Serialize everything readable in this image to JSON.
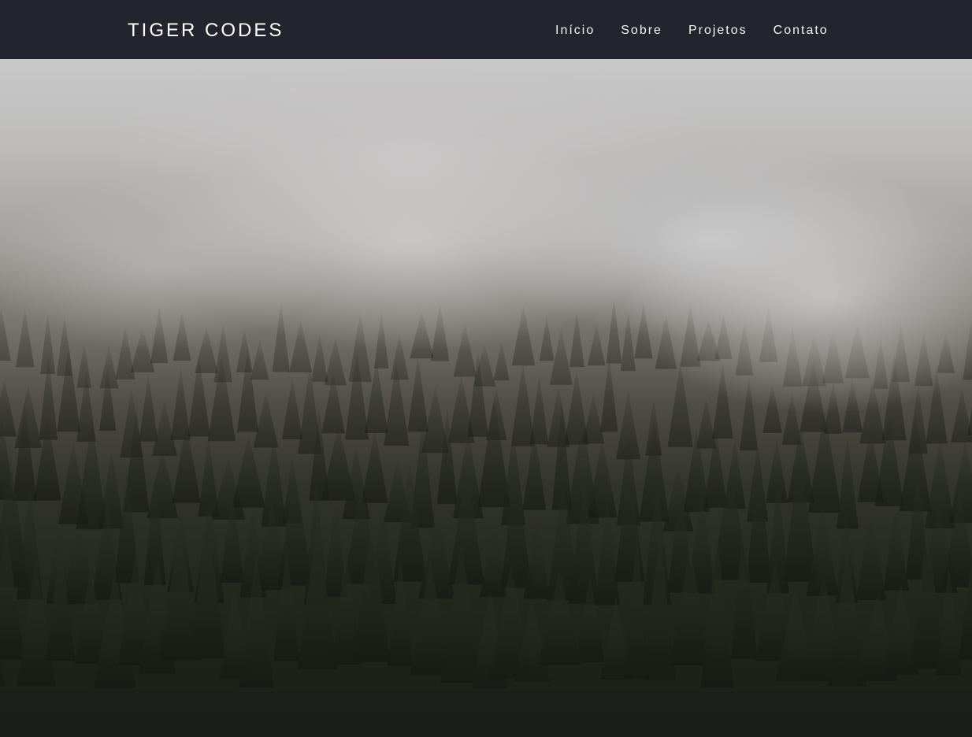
{
  "site": {
    "brand": "TIGER CODES"
  },
  "nav": {
    "items": [
      {
        "label": "Início"
      },
      {
        "label": "Sobre"
      },
      {
        "label": "Projetos"
      },
      {
        "label": "Contato"
      }
    ]
  },
  "hero": {
    "image": "foggy-forest-photo"
  },
  "colors": {
    "navbar": "#24242f",
    "text": "#ffffff"
  }
}
